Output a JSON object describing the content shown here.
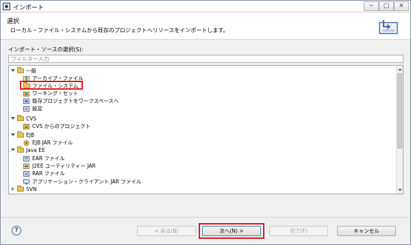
{
  "window": {
    "title": "インポート",
    "minimize": "─",
    "maximize": "□",
    "close": "✕"
  },
  "header": {
    "title": "選択",
    "description": "ローカル・ファイル・システムから既存のプロジェクトへリソースをインポートします。"
  },
  "source_section": {
    "label": "インポート・ソースの選択(S):",
    "filter_placeholder": "フィルター入力"
  },
  "tree": [
    {
      "label": "一般",
      "type": "folder",
      "expanded": true
    },
    {
      "label": "アーカイブ・ファイル",
      "type": "archive-icon"
    },
    {
      "label": "ファイル・システム",
      "type": "folder",
      "selected": true
    },
    {
      "label": "ワーキング・セット",
      "type": "workingset-icon"
    },
    {
      "label": "既存プロジェクトをワークスペースへ",
      "type": "project-icon"
    },
    {
      "label": "設定",
      "type": "preferences-icon"
    },
    {
      "label": "CVS",
      "type": "folder",
      "expanded": true
    },
    {
      "label": "CVS からのプロジェクト",
      "type": "cvs-icon"
    },
    {
      "label": "EJB",
      "type": "folder",
      "expanded": true
    },
    {
      "label": "EJB JAR ファイル",
      "type": "ejb-icon"
    },
    {
      "label": "Java EE",
      "type": "folder",
      "expanded": true
    },
    {
      "label": "EAR ファイル",
      "type": "ear-icon"
    },
    {
      "label": "J2EE ユーティリティー JAR",
      "type": "jar-icon"
    },
    {
      "label": "RAR ファイル",
      "type": "rar-icon"
    },
    {
      "label": "アプリケーション・クライアント JAR ファイル",
      "type": "client-jar-icon"
    },
    {
      "label": "SVN",
      "type": "folder",
      "expanded": false
    }
  ],
  "buttons": {
    "help": "?",
    "back": "< 戻る(B)",
    "next": "次へ(N) >",
    "finish": "完了(F)",
    "cancel": "キャンセル"
  },
  "colors": {
    "highlight": "#e4141c",
    "folder": "#e6c257",
    "default_button_border": "#3c7fb1"
  }
}
